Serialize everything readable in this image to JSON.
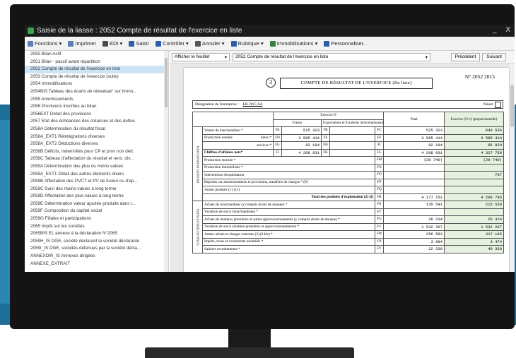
{
  "window": {
    "title": "Saisie de la liasse : 2052 Compte de résultat de l'exercice en liste",
    "minimize": "_",
    "close": "X"
  },
  "toolbar": {
    "items": [
      {
        "label": "Fonctions ▾",
        "icon": "gear-icon",
        "color": "#5a7fb5"
      },
      {
        "label": "Imprimer",
        "icon": "printer-icon",
        "color": "#5a7fb5"
      },
      {
        "label": "EDI ▾",
        "icon": "edi-icon",
        "color": "#4a4a4a"
      },
      {
        "label": "Saisir",
        "icon": "pencil-icon",
        "color": "#2c5fa8"
      },
      {
        "label": "Contrôler ▾",
        "icon": "check-icon",
        "color": "#2c5fa8"
      },
      {
        "label": "Annuler ▾",
        "icon": "undo-icon",
        "color": "#555555"
      },
      {
        "label": "Rubrique ▾",
        "icon": "list-icon",
        "color": "#2c5fa8"
      },
      {
        "label": "Immobilisations ▾",
        "icon": "building-icon",
        "color": "#3a7f3a"
      },
      {
        "label": "Personnaliser...",
        "icon": "settings-icon",
        "color": "#2c5fa8"
      }
    ]
  },
  "sidebar": {
    "items": [
      "2050 Bilan Actif",
      "2051 Bilan - passif avant répartition",
      "2052 Compte de résultat de l'exercice en liste",
      "2053 Compte de résultat de l'exercice (suite)",
      "2054 Immobilisations",
      "2054BIS Tableau des écarts de réévaluat° sur immo...",
      "2055 Amortissements",
      "2056 Provisions inscrites au bilan",
      "2056EXT Détail des provisions",
      "2057 Etat des échéances des créances et des dettes",
      "2058A Détermination du résultat fiscal",
      "2058A_EXT1 Réintégrations diverses",
      "2058A_EXT2 Déductions diverses",
      "2058B Déficits, indemnités pour CP et prov non déd.",
      "2058C Tableau d'affectation du résultat et rens. div...",
      "2059A Détermination des plus ou moins values",
      "2059A_EXT1 Détail des autres éléments divers",
      "2059B Affectation des PVCT et PV de fusion ou d'ap...",
      "2059C Suivi des moins-values à long terme",
      "2059D Affectation des plus-values à long terme",
      "2059E Détermination valeur ajoutée produite dans l...",
      "2059F Composition du capital social",
      "2059G Filiales et participations",
      "2065 Impôt sur les sociétés",
      "2065BIS EL annexe à la déclaration N°2065",
      "2059H_IS DGE, société déclarant la société déclarante",
      "2059I_IS DGE, sociétés détenues par la société décla...",
      "ANNEXDIR_IS Annexes dirigées",
      "ANNEXE_EXTRAIT"
    ],
    "selected_index": 2
  },
  "content": {
    "sheet_select": "Afficher le feuillet",
    "form_select": "2052 Compte de résultat de l'exercice en liste",
    "prev_button": "Précédent",
    "next_button": "Suivant"
  },
  "doc": {
    "number": "3",
    "title": "COMPTE DE RÉSULTAT DE L'EXERCICE (En liste)",
    "ref": "N° 2052 2015",
    "designation_label": "Désignation de l'entreprise :",
    "designation_value": "EB 2015 SA",
    "neant": "Néant",
    "header": {
      "exercice": "Exercice N",
      "france": "France",
      "export": "Exportations et livraisons intracommunautaires",
      "total": "Total",
      "prev": "Exercice (N-1) (proportionnelle)"
    },
    "section_label": "PRODUITS D'EXPLOITATION",
    "section2_label": "CHARGES D'EXPLOITATION",
    "rows": [
      {
        "label": "Ventes de marchandises *",
        "c1": "FA",
        "france": "525 323",
        "c2": "FB",
        "export": "",
        "c3": "FC",
        "total": "525 323",
        "prev": "646 536"
      },
      {
        "label": "Production vendue",
        "sub": "biens *",
        "c1": "FD",
        "france": "3 585 414",
        "c2": "FE",
        "export": "",
        "c3": "FF",
        "total": "3 585 414",
        "prev": "3 585 414"
      },
      {
        "label": "",
        "sub": "services *",
        "c1": "FG",
        "france": "92 194",
        "c2": "FH",
        "export": "",
        "c3": "FI",
        "total": "92 194",
        "prev": "95 829"
      },
      {
        "label": "Chiffres d'affaires nets*",
        "c1": "FJ",
        "france": "4 208 931",
        "c2": "FK",
        "export": "",
        "c3": "FL",
        "total": "4 208 931",
        "prev": "4 327 758"
      },
      {
        "label": "Production stockée *",
        "c3": "FM",
        "total": "(29 740)",
        "prev": "(29 740)"
      },
      {
        "label": "Production immobilisée *",
        "c3": "FN",
        "total": "",
        "prev": ""
      },
      {
        "label": "Subventions d'exploitation",
        "c3": "FO",
        "total": "",
        "prev": "767"
      },
      {
        "label": "Reprises sur amortissements et provisions, transferts de charges * (9)",
        "c3": "FP",
        "total": "",
        "prev": ""
      },
      {
        "label": "Autres produits (1) (11)",
        "c3": "FQ",
        "total": "",
        "prev": ""
      },
      {
        "label": "Total des produits d'exploitation (2) (I)",
        "c3": "FR",
        "total": "4 177 151",
        "prev": "4 298 786"
      },
      {
        "label": "Achats de marchandises (y compris droits de douane) *",
        "c3": "FS",
        "total": "135 541",
        "prev": "215 530"
      },
      {
        "label": "Variation de stock (marchandises) *",
        "c3": "FT",
        "total": "",
        "prev": ""
      },
      {
        "label": "Achats de matières premières et autres approvisionnements (y compris droits de douane) *",
        "c3": "FU",
        "total": "26 334",
        "prev": "26 324"
      },
      {
        "label": "Variation de stock (matière premières et approvisionnements) *",
        "c3": "FV",
        "total": "1 532 267",
        "prev": "1 532 267"
      },
      {
        "label": "Autres achats et charges externes (3) (6 bis) *",
        "c3": "FW",
        "total": "256 583",
        "prev": "317 145"
      },
      {
        "label": "Impôts, taxes et versements assimilés *",
        "c3": "FX",
        "total": "3 084",
        "prev": "3 474"
      },
      {
        "label": "Salaires et traitements *",
        "c3": "FY",
        "total": "22 330",
        "prev": "48 330"
      }
    ]
  }
}
